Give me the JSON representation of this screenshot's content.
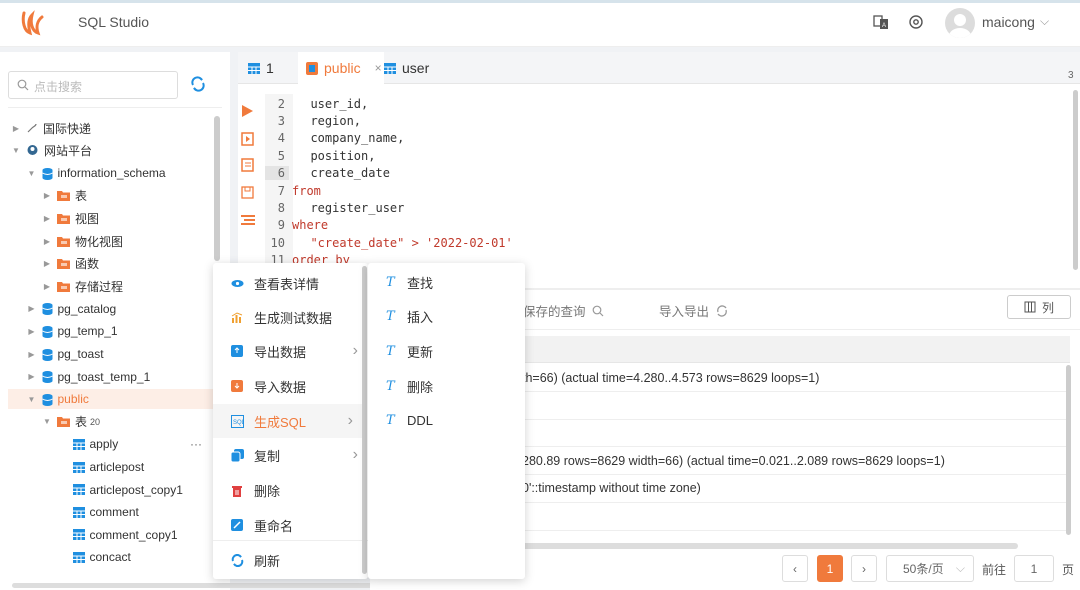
{
  "app": {
    "title": "SQL Studio",
    "user": "maicong"
  },
  "sidebar": {
    "search_placeholder": "点击搜索",
    "tree": [
      {
        "label": "国际快递",
        "depth": 0,
        "expand": "right",
        "icon": "connection-icon"
      },
      {
        "label": "网站平台",
        "depth": 0,
        "expand": "down",
        "icon": "postgres-icon"
      },
      {
        "label": "information_schema",
        "depth": 1,
        "expand": "down",
        "icon": "database-icon"
      },
      {
        "label": "表",
        "depth": 2,
        "expand": "right",
        "icon": "folder-icon"
      },
      {
        "label": "视图",
        "depth": 2,
        "expand": "right",
        "icon": "folder-icon"
      },
      {
        "label": "物化视图",
        "depth": 2,
        "expand": "right",
        "icon": "folder-icon"
      },
      {
        "label": "函数",
        "depth": 2,
        "expand": "right",
        "icon": "folder-icon"
      },
      {
        "label": "存储过程",
        "depth": 2,
        "expand": "right",
        "icon": "folder-icon"
      },
      {
        "label": "pg_catalog",
        "depth": 1,
        "expand": "right",
        "icon": "database-icon"
      },
      {
        "label": "pg_temp_1",
        "depth": 1,
        "expand": "right",
        "icon": "database-icon"
      },
      {
        "label": "pg_toast",
        "depth": 1,
        "expand": "right",
        "icon": "database-icon"
      },
      {
        "label": "pg_toast_temp_1",
        "depth": 1,
        "expand": "right",
        "icon": "database-icon"
      },
      {
        "label": "public",
        "depth": 1,
        "expand": "down",
        "icon": "database-icon",
        "selected": true
      },
      {
        "label": "表",
        "depth": 2,
        "expand": "down",
        "icon": "folder-icon",
        "badge": "20"
      },
      {
        "label": "apply",
        "depth": 3,
        "expand": "",
        "icon": "table-icon",
        "more": "···"
      },
      {
        "label": "articlepost",
        "depth": 3,
        "expand": "",
        "icon": "table-icon"
      },
      {
        "label": "articlepost_copy1",
        "depth": 3,
        "expand": "",
        "icon": "table-icon"
      },
      {
        "label": "comment",
        "depth": 3,
        "expand": "",
        "icon": "table-icon"
      },
      {
        "label": "comment_copy1",
        "depth": 3,
        "expand": "",
        "icon": "table-icon"
      },
      {
        "label": "concact",
        "depth": 3,
        "expand": "",
        "icon": "table-icon"
      }
    ]
  },
  "tabs": [
    {
      "label": "1",
      "active": false
    },
    {
      "label": "public",
      "active": true,
      "close": "×"
    },
    {
      "label": "user",
      "active": false
    }
  ],
  "tab_overflow": "3",
  "editor": {
    "lines": [
      {
        "n": "2",
        "text": "  user_id,",
        "type": "plain"
      },
      {
        "n": "3",
        "text": "  region,",
        "type": "plain"
      },
      {
        "n": "4",
        "text": "  company_name,",
        "type": "plain"
      },
      {
        "n": "5",
        "text": "  position,",
        "type": "plain"
      },
      {
        "n": "6",
        "text": "  create_date",
        "type": "plain"
      },
      {
        "n": "7",
        "text": "from",
        "type": "kw"
      },
      {
        "n": "8",
        "text": "  register_user",
        "type": "plain"
      },
      {
        "n": "9",
        "text": "where",
        "type": "kw"
      },
      {
        "n": "10",
        "text": "  \"create_date\" > '2022-02-01'",
        "type": "str"
      },
      {
        "n": "11",
        "text": "order by",
        "type": "kw"
      }
    ]
  },
  "results": {
    "toolbar": {
      "saved_query": "保存的查询",
      "import_export": "导入导出",
      "columns": "列"
    },
    "rows": [
      "th=66) (actual time=4.280..4.573 rows=8629 loops=1)",
      "",
      "",
      "280.89 rows=8629 width=66) (actual time=0.021..2.089 rows=8629 loops=1)",
      "0'::timestamp without time zone)",
      ""
    ],
    "pager": {
      "prev": "‹",
      "page": "1",
      "next": "›",
      "per_page": "50条/页",
      "goto_label": "前往",
      "goto_value": "1",
      "page_suffix": "页"
    }
  },
  "context_menu": {
    "items": [
      {
        "label": "查看表详情",
        "icon": "eye-icon",
        "color": "#1f8fe0"
      },
      {
        "label": "生成测试数据",
        "icon": "chart-icon",
        "color": "#f0a030"
      },
      {
        "label": "导出数据",
        "icon": "export-icon",
        "color": "#1f8fe0",
        "submenu": true
      },
      {
        "label": "导入数据",
        "icon": "import-icon",
        "color": "#f07a3c"
      },
      {
        "label": "生成SQL",
        "icon": "sql-icon",
        "color": "#1f8fe0",
        "submenu": true,
        "highlighted": true
      },
      {
        "label": "复制",
        "icon": "copy-icon",
        "color": "#1f8fe0",
        "submenu": true
      },
      {
        "label": "删除",
        "icon": "trash-icon",
        "color": "#e04040"
      },
      {
        "label": "重命名",
        "icon": "rename-icon",
        "color": "#1f8fe0"
      },
      {
        "label": "刷新",
        "icon": "refresh-icon",
        "color": "#1f8fe0"
      }
    ]
  },
  "sql_submenu": {
    "items": [
      "查找",
      "插入",
      "更新",
      "删除",
      "DDL"
    ]
  },
  "colors": {
    "accent": "#f07a3c",
    "blue": "#1f8fe0"
  }
}
